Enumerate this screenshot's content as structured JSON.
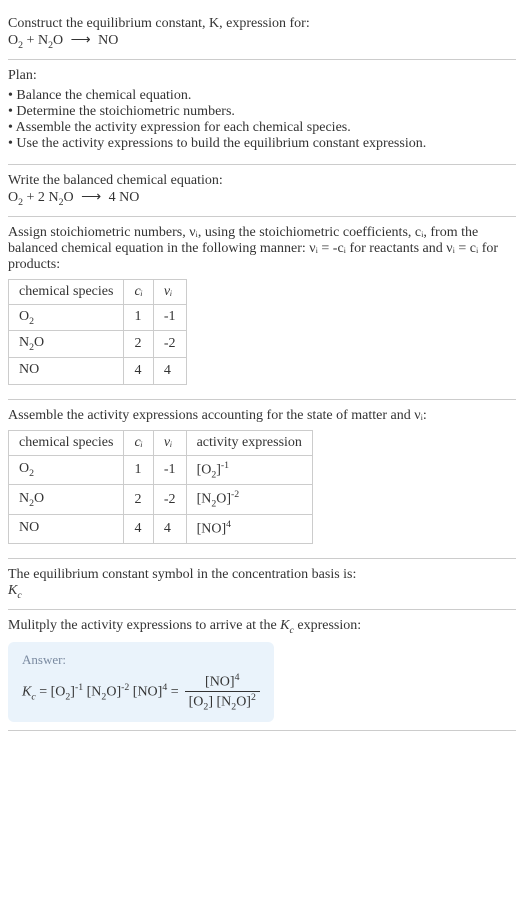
{
  "intro": {
    "line1": "Construct the equilibrium constant, K, expression for:",
    "equation_lhs1": "O",
    "equation_lhs1_sub": "2",
    "plus": " + ",
    "equation_lhs2": "N",
    "equation_lhs2_sub": "2",
    "equation_lhs2b": "O",
    "arrow": "⟶",
    "equation_rhs": "NO"
  },
  "plan": {
    "title": "Plan:",
    "items": [
      "Balance the chemical equation.",
      "Determine the stoichiometric numbers.",
      "Assemble the activity expression for each chemical species.",
      "Use the activity expressions to build the equilibrium constant expression."
    ]
  },
  "balanced": {
    "title": "Write the balanced chemical equation:",
    "o2": "O",
    "o2_sub": "2",
    "plus": " + 2 ",
    "n2o_n": "N",
    "n2o_sub": "2",
    "n2o_o": "O",
    "arrow": "⟶",
    "rhs": " 4 NO"
  },
  "stoich": {
    "intro": "Assign stoichiometric numbers, νᵢ, using the stoichiometric coefficients, cᵢ, from the balanced chemical equation in the following manner: νᵢ = -cᵢ for reactants and νᵢ = cᵢ for products:",
    "headers": [
      "chemical species",
      "cᵢ",
      "νᵢ"
    ],
    "rows": [
      {
        "species_a": "O",
        "species_sub": "2",
        "species_b": "",
        "c": "1",
        "v": "-1"
      },
      {
        "species_a": "N",
        "species_sub": "2",
        "species_b": "O",
        "c": "2",
        "v": "-2"
      },
      {
        "species_a": "NO",
        "species_sub": "",
        "species_b": "",
        "c": "4",
        "v": "4"
      }
    ]
  },
  "activity": {
    "intro": "Assemble the activity expressions accounting for the state of matter and νᵢ:",
    "headers": [
      "chemical species",
      "cᵢ",
      "νᵢ",
      "activity expression"
    ],
    "rows": [
      {
        "species_a": "O",
        "species_sub": "2",
        "species_b": "",
        "c": "1",
        "v": "-1",
        "expr_base_a": "[O",
        "expr_sub": "2",
        "expr_base_b": "]",
        "expr_sup": "-1"
      },
      {
        "species_a": "N",
        "species_sub": "2",
        "species_b": "O",
        "c": "2",
        "v": "-2",
        "expr_base_a": "[N",
        "expr_sub": "2",
        "expr_base_b": "O]",
        "expr_sup": "-2"
      },
      {
        "species_a": "NO",
        "species_sub": "",
        "species_b": "",
        "c": "4",
        "v": "4",
        "expr_base_a": "[NO]",
        "expr_sub": "",
        "expr_base_b": "",
        "expr_sup": "4"
      }
    ]
  },
  "symbol": {
    "line": "The equilibrium constant symbol in the concentration basis is:",
    "kc": "K",
    "kc_sub": "c"
  },
  "multiply": {
    "line_a": "Mulitply the activity expressions to arrive at the ",
    "kc": "K",
    "kc_sub": "c",
    "line_b": " expression:"
  },
  "answer": {
    "label": "Answer:",
    "kc": "K",
    "kc_sub": "c",
    "eq": " = ",
    "t1_a": "[O",
    "t1_sub": "2",
    "t1_b": "]",
    "t1_sup": "-1",
    "t2_a": " [N",
    "t2_sub": "2",
    "t2_b": "O]",
    "t2_sup": "-2",
    "t3_a": " [NO]",
    "t3_sup": "4",
    "eq2": " = ",
    "num_a": "[NO]",
    "num_sup": "4",
    "den1_a": "[O",
    "den1_sub": "2",
    "den1_b": "] ",
    "den2_a": "[N",
    "den2_sub": "2",
    "den2_b": "O]",
    "den2_sup": "2"
  }
}
